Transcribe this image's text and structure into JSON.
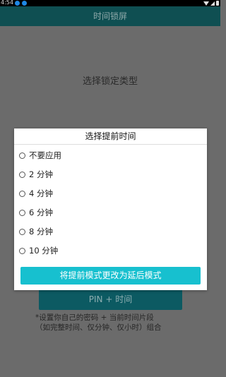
{
  "status_bar": {
    "time": "4:54",
    "icons": [
      "notification-icon",
      "notification-icon",
      "wifi-icon",
      "signal-icon",
      "battery-icon"
    ]
  },
  "app_bar": {
    "title": "时间锁屏",
    "color": "#0f4f52"
  },
  "main": {
    "lock_type_title": "选择锁定类型",
    "pin_time_button": "PIN + 时间",
    "hint_line1": "*设置你自己的密码 + 当前时间片段",
    "hint_line2": "（如完整时间、仅分钟、仅小时）组合"
  },
  "dialog": {
    "title": "选择提前时间",
    "options": [
      {
        "label": "不要应用",
        "selected": false
      },
      {
        "label": "2 分钟",
        "selected": false
      },
      {
        "label": "4 分钟",
        "selected": false
      },
      {
        "label": "6 分钟",
        "selected": false
      },
      {
        "label": "8 分钟",
        "selected": false
      },
      {
        "label": "10 分钟",
        "selected": false
      }
    ],
    "switch_button": "将提前模式更改为延后模式",
    "accent_color": "#17c0cf"
  }
}
